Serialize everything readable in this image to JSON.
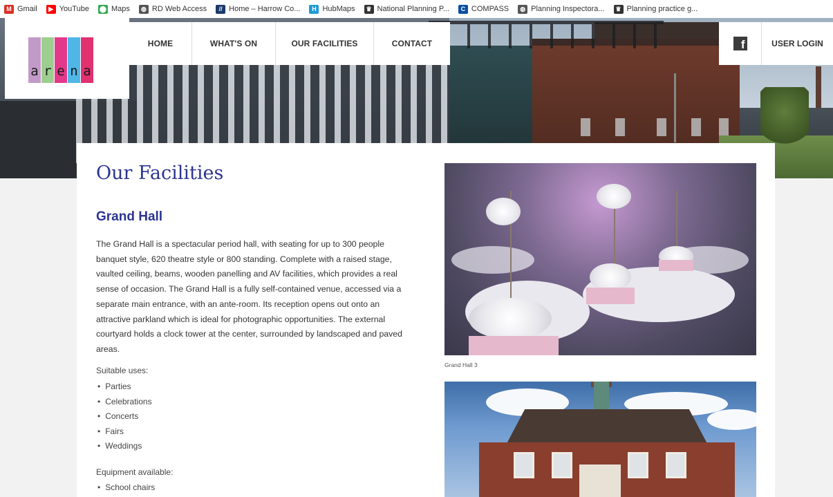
{
  "bookmarks": [
    {
      "label": "Gmail",
      "icon": "gmail-icon",
      "color": "#d93025",
      "glyph": "M"
    },
    {
      "label": "YouTube",
      "icon": "youtube-icon",
      "color": "#ff0000",
      "glyph": "▶"
    },
    {
      "label": "Maps",
      "icon": "maps-icon",
      "color": "#34a853",
      "glyph": "⬤"
    },
    {
      "label": "RD Web Access",
      "icon": "globe-icon",
      "color": "#555555",
      "glyph": "◍"
    },
    {
      "label": "Home – Harrow Co...",
      "icon": "harrow-icon",
      "color": "#1a3a6b",
      "glyph": "//"
    },
    {
      "label": "HubMaps",
      "icon": "hubmaps-icon",
      "color": "#1e9ad6",
      "glyph": "H"
    },
    {
      "label": "National Planning P...",
      "icon": "gov-crest-icon",
      "color": "#333333",
      "glyph": "♛"
    },
    {
      "label": "COMPASS",
      "icon": "compass-icon",
      "color": "#0b4ea2",
      "glyph": "C"
    },
    {
      "label": "Planning Inspectora...",
      "icon": "globe-icon",
      "color": "#555555",
      "glyph": "◍"
    },
    {
      "label": "Planning practice g...",
      "icon": "gov-crest-icon",
      "color": "#333333",
      "glyph": "♛"
    }
  ],
  "logo": {
    "letters": [
      "a",
      "r",
      "e",
      "n",
      "a"
    ],
    "bar_colors": [
      "#c29ac8",
      "#9ccf8f",
      "#e2398a",
      "#4fb7e6",
      "#e0326e"
    ]
  },
  "nav": {
    "items": [
      "HOME",
      "WHAT'S ON",
      "OUR FACILITIES",
      "CONTACT"
    ],
    "facebook_glyph": "f",
    "login": "USER LOGIN"
  },
  "page": {
    "title": "Our Facilities",
    "section_title": "Grand Hall",
    "description": "The Grand Hall is a spectacular period hall, with seating for up to 300 people banquet style, 620 theatre style or 800 standing. Complete with a raised stage, vaulted ceiling, beams, wooden panelling and AV facilities, which provides a real sense of occasion. The Grand Hall is a fully self-contained venue, accessed via a separate main entrance, with an ante-room. Its reception opens out onto an attractive parkland which is ideal for photographic opportunities. The external courtyard holds a clock tower at the center, surrounded by landscaped and paved areas.",
    "uses_heading": "Suitable uses:",
    "uses": [
      "Parties",
      "Celebrations",
      "Concerts",
      "Fairs",
      "Weddings"
    ],
    "equipment_heading": "Equipment available:",
    "equipment": [
      "School chairs"
    ],
    "image1_caption": "Grand Hall 3"
  }
}
